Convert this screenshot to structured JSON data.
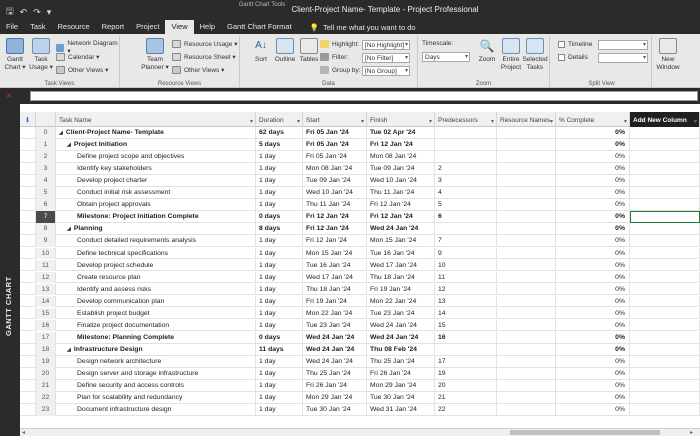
{
  "titlebar": {
    "title": "Client-Project Name- Template  -  Project Professional",
    "tools_label": "Gantt Chart Tools",
    "qat": [
      "save-icon",
      "undo-icon",
      "redo-icon",
      "customize-icon"
    ]
  },
  "tabs": [
    {
      "label": "File"
    },
    {
      "label": "Task"
    },
    {
      "label": "Resource"
    },
    {
      "label": "Report"
    },
    {
      "label": "Project"
    },
    {
      "label": "View",
      "active": true
    },
    {
      "label": "Help"
    },
    {
      "label": "Gantt Chart Format"
    }
  ],
  "tell_me": "Tell me what you want to do",
  "ribbon": {
    "task_views": {
      "label": "Task Views",
      "gantt_chart": "Gantt Chart ▾",
      "task_usage": "Task Usage ▾",
      "network_diagram": "Network Diagram ▾",
      "calendar": "Calendar ▾",
      "other_views": "Other Views ▾"
    },
    "resource_views": {
      "label": "Resource Views",
      "team_planner": "Team Planner ▾",
      "resource_usage": "Resource Usage ▾",
      "resource_sheet": "Resource Sheet ▾",
      "other_views": "Other Views ▾"
    },
    "data": {
      "label": "Data",
      "sort": "Sort",
      "outline": "Outline",
      "tables": "Tables",
      "highlight_label": "Highlight:",
      "highlight_value": "[No Highlight]",
      "filter_label": "Filter:",
      "filter_value": "[No Filter]",
      "group_label": "Group by:",
      "group_value": "[No Group]"
    },
    "zoom": {
      "label": "Zoom",
      "timescale_label": "Timescale:",
      "timescale_value": "Days",
      "zoom": "Zoom",
      "entire_project": "Entire Project",
      "selected_tasks": "Selected Tasks"
    },
    "split_view": {
      "label": "Split View",
      "timeline": "Timeline",
      "details": "Details"
    },
    "window": {
      "new_window": "New Window"
    }
  },
  "sidebar_label": "GANTT CHART",
  "columns": {
    "task_name": "Task Name",
    "duration": "Duration",
    "start": "Start",
    "finish": "Finish",
    "predecessors": "Predecessors",
    "resource_names": "Resource Names",
    "percent_complete": "% Complete",
    "add_new": "Add New Column"
  },
  "rows": [
    {
      "id": "0",
      "name": "Client-Project Name- Template",
      "level": 0,
      "summary": true,
      "duration": "62 days",
      "start": "Fri 05 Jan '24",
      "finish": "Tue 02 Apr '24",
      "pred": "",
      "pct": "0%"
    },
    {
      "id": "1",
      "name": "Project Initiation",
      "level": 1,
      "summary": true,
      "duration": "5 days",
      "start": "Fri 05 Jan '24",
      "finish": "Fri 12 Jan '24",
      "pred": "",
      "pct": "0%"
    },
    {
      "id": "2",
      "name": "Define project scope and objectives",
      "level": 2,
      "summary": false,
      "duration": "1 day",
      "start": "Fri 05 Jan '24",
      "finish": "Mon 08 Jan '24",
      "pred": "",
      "pct": "0%"
    },
    {
      "id": "3",
      "name": "Identify key stakeholders",
      "level": 2,
      "summary": false,
      "duration": "1 day",
      "start": "Mon 08 Jan '24",
      "finish": "Tue 09 Jan '24",
      "pred": "2",
      "pct": "0%"
    },
    {
      "id": "4",
      "name": "Develop project charter",
      "level": 2,
      "summary": false,
      "duration": "1 day",
      "start": "Tue 09 Jan '24",
      "finish": "Wed 10 Jan '24",
      "pred": "3",
      "pct": "0%"
    },
    {
      "id": "5",
      "name": "Conduct initial risk assessment",
      "level": 2,
      "summary": false,
      "duration": "1 day",
      "start": "Wed 10 Jan '24",
      "finish": "Thu 11 Jan '24",
      "pred": "4",
      "pct": "0%"
    },
    {
      "id": "6",
      "name": "Obtain project approvals",
      "level": 2,
      "summary": false,
      "duration": "1 day",
      "start": "Thu 11 Jan '24",
      "finish": "Fri 12 Jan '24",
      "pred": "5",
      "pct": "0%"
    },
    {
      "id": "7",
      "name": "Milestone: Project Initiation Complete",
      "level": 2,
      "summary": false,
      "milestone": true,
      "selected": true,
      "duration": "0 days",
      "start": "Fri 12 Jan '24",
      "finish": "Fri 12 Jan '24",
      "pred": "6",
      "pct": "0%"
    },
    {
      "id": "8",
      "name": "Planning",
      "level": 1,
      "summary": true,
      "duration": "8 days",
      "start": "Fri 12 Jan '24",
      "finish": "Wed 24 Jan '24",
      "pred": "",
      "pct": "0%"
    },
    {
      "id": "9",
      "name": "Conduct detailed requirements analysis",
      "level": 2,
      "summary": false,
      "duration": "1 day",
      "start": "Fri 12 Jan '24",
      "finish": "Mon 15 Jan '24",
      "pred": "7",
      "pct": "0%"
    },
    {
      "id": "10",
      "name": "Define technical specifications",
      "level": 2,
      "summary": false,
      "duration": "1 day",
      "start": "Mon 15 Jan '24",
      "finish": "Tue 16 Jan '24",
      "pred": "9",
      "pct": "0%"
    },
    {
      "id": "11",
      "name": "Develop project schedule",
      "level": 2,
      "summary": false,
      "duration": "1 day",
      "start": "Tue 16 Jan '24",
      "finish": "Wed 17 Jan '24",
      "pred": "10",
      "pct": "0%"
    },
    {
      "id": "12",
      "name": "Create resource plan",
      "level": 2,
      "summary": false,
      "duration": "1 day",
      "start": "Wed 17 Jan '24",
      "finish": "Thu 18 Jan '24",
      "pred": "11",
      "pct": "0%"
    },
    {
      "id": "13",
      "name": "Identify and assess risks",
      "level": 2,
      "summary": false,
      "duration": "1 day",
      "start": "Thu 18 Jan '24",
      "finish": "Fri 19 Jan '24",
      "pred": "12",
      "pct": "0%"
    },
    {
      "id": "14",
      "name": "Develop communication plan",
      "level": 2,
      "summary": false,
      "duration": "1 day",
      "start": "Fri 19 Jan '24",
      "finish": "Mon 22 Jan '24",
      "pred": "13",
      "pct": "0%"
    },
    {
      "id": "15",
      "name": "Establish project budget",
      "level": 2,
      "summary": false,
      "duration": "1 day",
      "start": "Mon 22 Jan '24",
      "finish": "Tue 23 Jan '24",
      "pred": "14",
      "pct": "0%"
    },
    {
      "id": "16",
      "name": "Finalize project documentation",
      "level": 2,
      "summary": false,
      "duration": "1 day",
      "start": "Tue 23 Jan '24",
      "finish": "Wed 24 Jan '24",
      "pred": "15",
      "pct": "0%"
    },
    {
      "id": "17",
      "name": "Milestone: Planning Complete",
      "level": 2,
      "summary": false,
      "milestone": true,
      "duration": "0 days",
      "start": "Wed 24 Jan '24",
      "finish": "Wed 24 Jan '24",
      "pred": "16",
      "pct": "0%"
    },
    {
      "id": "18",
      "name": "Infrastructure Design",
      "level": 1,
      "summary": true,
      "duration": "11 days",
      "start": "Wed 24 Jan '24",
      "finish": "Thu 08 Feb '24",
      "pred": "",
      "pct": "0%"
    },
    {
      "id": "19",
      "name": "Design network architecture",
      "level": 2,
      "summary": false,
      "duration": "1 day",
      "start": "Wed 24 Jan '24",
      "finish": "Thu 25 Jan '24",
      "pred": "17",
      "pct": "0%"
    },
    {
      "id": "20",
      "name": "Design server and storage infrastructure",
      "level": 2,
      "summary": false,
      "duration": "1 day",
      "start": "Thu 25 Jan '24",
      "finish": "Fri 26 Jan '24",
      "pred": "19",
      "pct": "0%"
    },
    {
      "id": "21",
      "name": "Define security and access controls",
      "level": 2,
      "summary": false,
      "duration": "1 day",
      "start": "Fri 26 Jan '24",
      "finish": "Mon 29 Jan '24",
      "pred": "20",
      "pct": "0%"
    },
    {
      "id": "22",
      "name": "Plan for scalability and redundancy",
      "level": 2,
      "summary": false,
      "duration": "1 day",
      "start": "Mon 29 Jan '24",
      "finish": "Tue 30 Jan '24",
      "pred": "21",
      "pct": "0%"
    },
    {
      "id": "23",
      "name": "Document infrastructure design",
      "level": 2,
      "summary": false,
      "duration": "1 day",
      "start": "Tue 30 Jan '24",
      "finish": "Wed 31 Jan '24",
      "pred": "22",
      "pct": "0%"
    }
  ]
}
